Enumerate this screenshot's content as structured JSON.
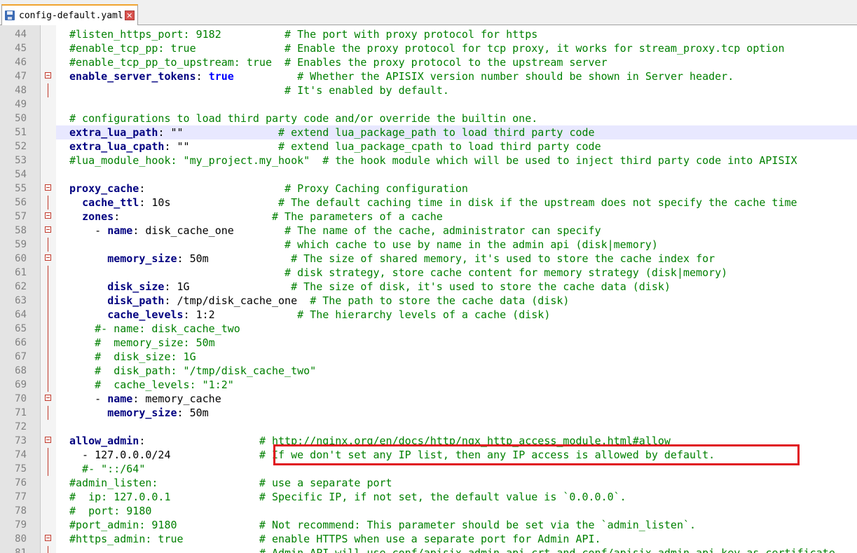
{
  "tab": {
    "filename": "config-default.yaml",
    "close_glyph": "✕"
  },
  "editor": {
    "current_line_index": 7,
    "lines": [
      {
        "n": "44",
        "fold": "",
        "segs": [
          [
            "c",
            "#listen_https_port: 9182          # The port with proxy protocol for https"
          ]
        ]
      },
      {
        "n": "45",
        "fold": "",
        "segs": [
          [
            "c",
            "#enable_tcp_pp: true              # Enable the proxy protocol for tcp proxy, it works for stream_proxy.tcp option"
          ]
        ]
      },
      {
        "n": "46",
        "fold": "",
        "segs": [
          [
            "c",
            "#enable_tcp_pp_to_upstream: true  # Enables the proxy protocol to the upstream server"
          ]
        ]
      },
      {
        "n": "47",
        "fold": "open",
        "segs": [
          [
            "k",
            "enable_server_tokens"
          ],
          [
            "v",
            ": "
          ],
          [
            "b",
            "true"
          ],
          [
            "v",
            "        "
          ],
          [
            "c",
            "  # Whether the APISIX version number should be shown in Server header."
          ]
        ]
      },
      {
        "n": "48",
        "fold": "line",
        "segs": [
          [
            "c",
            "                                  # It's enabled by default."
          ]
        ]
      },
      {
        "n": "49",
        "fold": "",
        "segs": [
          [
            "v",
            ""
          ]
        ]
      },
      {
        "n": "50",
        "fold": "",
        "segs": [
          [
            "c",
            "# configurations to load third party code and/or override the builtin one."
          ]
        ]
      },
      {
        "n": "51",
        "fold": "",
        "segs": [
          [
            "k",
            "extra_lua_path"
          ],
          [
            "v",
            ": \"\"               "
          ],
          [
            "c",
            "# extend lua_package_path to load third party code"
          ]
        ]
      },
      {
        "n": "52",
        "fold": "",
        "segs": [
          [
            "k",
            "extra_lua_cpath"
          ],
          [
            "v",
            ": \"\"              "
          ],
          [
            "c",
            "# extend lua_package_cpath to load third party code"
          ]
        ]
      },
      {
        "n": "53",
        "fold": "",
        "segs": [
          [
            "c",
            "#lua_module_hook: \"my_project.my_hook\"  # the hook module which will be used to inject third party code into APISIX"
          ]
        ]
      },
      {
        "n": "54",
        "fold": "",
        "segs": [
          [
            "v",
            ""
          ]
        ]
      },
      {
        "n": "55",
        "fold": "open",
        "segs": [
          [
            "k",
            "proxy_cache"
          ],
          [
            "v",
            ":                      "
          ],
          [
            "c",
            "# Proxy Caching configuration"
          ]
        ]
      },
      {
        "n": "56",
        "fold": "line",
        "segs": [
          [
            "v",
            "  "
          ],
          [
            "k",
            "cache_ttl"
          ],
          [
            "v",
            ": 10s                 "
          ],
          [
            "c",
            "# The default caching time in disk if the upstream does not specify the cache time"
          ]
        ]
      },
      {
        "n": "57",
        "fold": "open",
        "segs": [
          [
            "v",
            "  "
          ],
          [
            "k",
            "zones"
          ],
          [
            "v",
            ":                        "
          ],
          [
            "c",
            "# The parameters of a cache"
          ]
        ]
      },
      {
        "n": "58",
        "fold": "open",
        "segs": [
          [
            "v",
            "    - "
          ],
          [
            "k",
            "name"
          ],
          [
            "v",
            ": disk_cache_one        "
          ],
          [
            "c",
            "# The name of the cache, administrator can specify"
          ]
        ]
      },
      {
        "n": "59",
        "fold": "line",
        "segs": [
          [
            "c",
            "                                  # which cache to use by name in the admin api (disk|memory)"
          ]
        ]
      },
      {
        "n": "60",
        "fold": "open",
        "segs": [
          [
            "v",
            "      "
          ],
          [
            "k",
            "memory_size"
          ],
          [
            "v",
            ": 50m             "
          ],
          [
            "c",
            "# The size of shared memory, it's used to store the cache index for"
          ]
        ]
      },
      {
        "n": "61",
        "fold": "line",
        "segs": [
          [
            "c",
            "                                  # disk strategy, store cache content for memory strategy (disk|memory)"
          ]
        ]
      },
      {
        "n": "62",
        "fold": "line",
        "segs": [
          [
            "v",
            "      "
          ],
          [
            "k",
            "disk_size"
          ],
          [
            "v",
            ": 1G                "
          ],
          [
            "c",
            "# The size of disk, it's used to store the cache data (disk)"
          ]
        ]
      },
      {
        "n": "63",
        "fold": "line",
        "segs": [
          [
            "v",
            "      "
          ],
          [
            "k",
            "disk_path"
          ],
          [
            "v",
            ": /tmp/disk_cache_one  "
          ],
          [
            "c",
            "# The path to store the cache data (disk)"
          ]
        ]
      },
      {
        "n": "64",
        "fold": "line",
        "segs": [
          [
            "v",
            "      "
          ],
          [
            "k",
            "cache_levels"
          ],
          [
            "v",
            ": 1:2             "
          ],
          [
            "c",
            "# The hierarchy levels of a cache (disk)"
          ]
        ]
      },
      {
        "n": "65",
        "fold": "line",
        "segs": [
          [
            "c",
            "    #- name: disk_cache_two"
          ]
        ]
      },
      {
        "n": "66",
        "fold": "line",
        "segs": [
          [
            "c",
            "    #  memory_size: 50m"
          ]
        ]
      },
      {
        "n": "67",
        "fold": "line",
        "segs": [
          [
            "c",
            "    #  disk_size: 1G"
          ]
        ]
      },
      {
        "n": "68",
        "fold": "line",
        "segs": [
          [
            "c",
            "    #  disk_path: \"/tmp/disk_cache_two\""
          ]
        ]
      },
      {
        "n": "69",
        "fold": "line",
        "segs": [
          [
            "c",
            "    #  cache_levels: \"1:2\""
          ]
        ]
      },
      {
        "n": "70",
        "fold": "open",
        "segs": [
          [
            "v",
            "    - "
          ],
          [
            "k",
            "name"
          ],
          [
            "v",
            ": memory_cache"
          ]
        ]
      },
      {
        "n": "71",
        "fold": "line",
        "segs": [
          [
            "v",
            "      "
          ],
          [
            "k",
            "memory_size"
          ],
          [
            "v",
            ": 50m"
          ]
        ]
      },
      {
        "n": "72",
        "fold": "",
        "segs": [
          [
            "v",
            ""
          ]
        ]
      },
      {
        "n": "73",
        "fold": "open",
        "segs": [
          [
            "k",
            "allow_admin"
          ],
          [
            "v",
            ":                  "
          ],
          [
            "c",
            "# http://nginx.org/en/docs/http/ngx_http_access_module.html#allow"
          ]
        ]
      },
      {
        "n": "74",
        "fold": "line",
        "segs": [
          [
            "v",
            "  - 127.0.0.0/24              "
          ],
          [
            "c",
            "# If we don't set any IP list, then any IP access is allowed by default."
          ]
        ]
      },
      {
        "n": "75",
        "fold": "line",
        "segs": [
          [
            "c",
            "  #- \"::/64\""
          ]
        ]
      },
      {
        "n": "76",
        "fold": "",
        "segs": [
          [
            "c",
            "#admin_listen:                # use a separate port"
          ]
        ]
      },
      {
        "n": "77",
        "fold": "",
        "segs": [
          [
            "c",
            "#  ip: 127.0.0.1              # Specific IP, if not set, the default value is `0.0.0.0`."
          ]
        ]
      },
      {
        "n": "78",
        "fold": "",
        "segs": [
          [
            "c",
            "#  port: 9180"
          ]
        ]
      },
      {
        "n": "79",
        "fold": "",
        "segs": [
          [
            "c",
            "#port_admin: 9180             # Not recommend: This parameter should be set via the `admin_listen`."
          ]
        ]
      },
      {
        "n": "80",
        "fold": "open",
        "segs": [
          [
            "c",
            "#https_admin: true            # enable HTTPS when use a separate port for Admin API."
          ]
        ]
      },
      {
        "n": "81",
        "fold": "line",
        "segs": [
          [
            "c",
            "                              # Admin API will use conf/apisix_admin_api.crt and conf/apisix_admin_api.key as certificate."
          ]
        ]
      }
    ]
  }
}
